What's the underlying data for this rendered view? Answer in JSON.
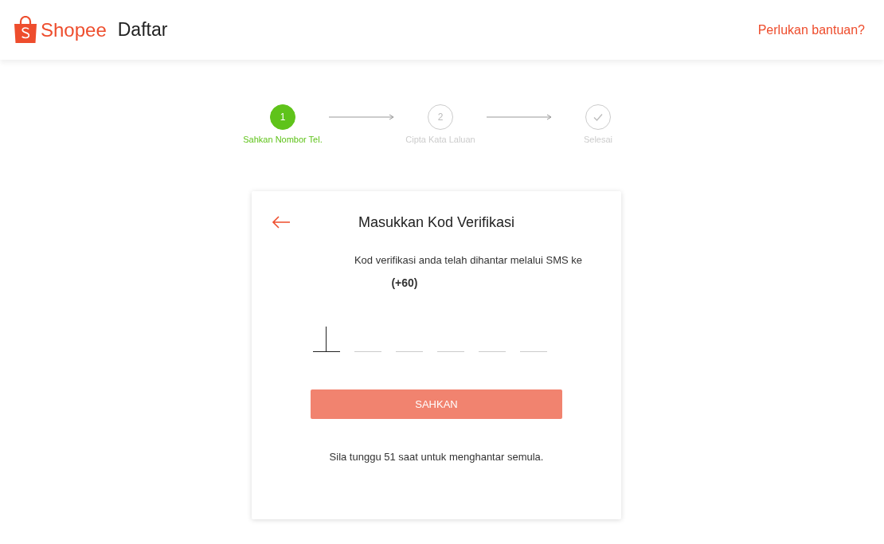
{
  "header": {
    "brand": "Shopee",
    "title": "Daftar",
    "help_link": "Perlukan bantuan?"
  },
  "steps": [
    {
      "marker": "1",
      "label": "Sahkan Nombor Tel.",
      "kind": "number",
      "selected": true
    },
    {
      "marker": "2",
      "label": "Cipta Kata Laluan",
      "kind": "number",
      "selected": false
    },
    {
      "label": "Selesai",
      "kind": "check",
      "selected": false
    }
  ],
  "card": {
    "title": "Masukkan Kod Verifikasi",
    "message": "Kod verifikasi anda telah dihantar melalui SMS ke",
    "phone": "(+60)",
    "code_fields": [
      {
        "focused": true
      },
      {
        "focused": false
      },
      {
        "focused": false
      },
      {
        "focused": false
      },
      {
        "focused": false
      },
      {
        "focused": false
      }
    ],
    "submit": {
      "label": "SAHKAN",
      "disabled": true
    },
    "resend_note": "Sila tunggu 51 saat untuk menghantar semula."
  }
}
